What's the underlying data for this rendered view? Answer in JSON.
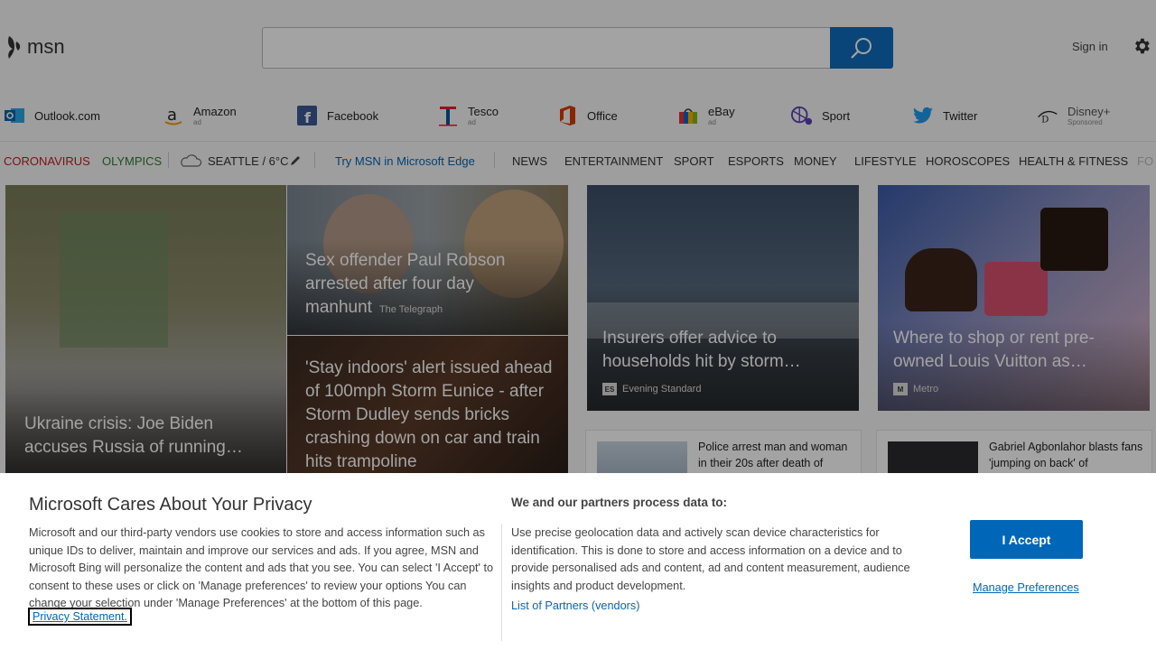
{
  "header": {
    "logo_text": "msn",
    "search": {
      "placeholder": "",
      "value": ""
    },
    "sign_in": "Sign in"
  },
  "quicklinks": [
    {
      "label": "Outlook.com",
      "sub": ""
    },
    {
      "label": "Amazon",
      "sub": "ad"
    },
    {
      "label": "Facebook",
      "sub": ""
    },
    {
      "label": "Tesco",
      "sub": "ad"
    },
    {
      "label": "Office",
      "sub": ""
    },
    {
      "label": "eBay",
      "sub": "ad"
    },
    {
      "label": "Sport",
      "sub": ""
    },
    {
      "label": "Twitter",
      "sub": ""
    },
    {
      "label": "Disney+",
      "sub": "Sponsored"
    }
  ],
  "nav": {
    "coronavirus": "CORONAVIRUS",
    "olympics": "OLYMPICS",
    "weather": "SEATTLE / 6°C",
    "edge": "Try MSN in Microsoft Edge",
    "items": [
      "NEWS",
      "ENTERTAINMENT",
      "SPORT",
      "ESPORTS",
      "MONEY",
      "LIFESTYLE",
      "HOROSCOPES",
      "HEALTH & FITNESS",
      "FO"
    ]
  },
  "tiles": {
    "ukraine": {
      "title": "Ukraine crisis: Joe Biden accuses Russia of running…"
    },
    "robson": {
      "title": "Sex offender Paul Robson arrested after four day manhunt",
      "source": "The Telegraph"
    },
    "storm_dudley": {
      "title": "'Stay indoors' alert issued ahead of 100mph Storm Eunice - after Storm Dudley sends bricks crashing down on car and train hits trampoline"
    },
    "insurers": {
      "title": "Insurers offer advice to households hit by storm…",
      "source": "Evening Standard",
      "badge": "ES"
    },
    "louis": {
      "title": "Where to shop or rent pre-owned Louis Vuitton as…",
      "source": "Metro",
      "badge": "M"
    },
    "police": {
      "title": "Police arrest man and woman in their 20s after death of"
    },
    "agbonlahor": {
      "title": "Gabriel Agbonlahor blasts fans 'jumping on back' of"
    }
  },
  "privacy": {
    "title": "Microsoft Cares About Your Privacy",
    "body": "Microsoft and our third-party vendors use cookies to store and access information such as unique IDs to deliver, maintain and improve our services and ads. If you agree, MSN and Microsoft Bing will personalize the content and ads that you see. You can select 'I Accept' to consent to these uses or click on 'Manage preferences' to review your options You can change your selection under 'Manage Preferences' at the bottom of this page.",
    "privacy_link": "Privacy Statement.",
    "subtitle": "We and our partners process data to:",
    "body2": "Use precise geolocation data and actively scan device characteristics for identification. This is done to store and access information on a device and to provide personalised ads and content, ad and content measurement, audience insights and product development.",
    "vendors_link": "List of Partners (vendors)",
    "accept": "I Accept",
    "manage": "Manage Preferences"
  },
  "colors": {
    "accent": "#0067b8",
    "coronavirus": "#c21f1f",
    "olympics": "#2e7d32",
    "edge_link": "#0067b8"
  }
}
